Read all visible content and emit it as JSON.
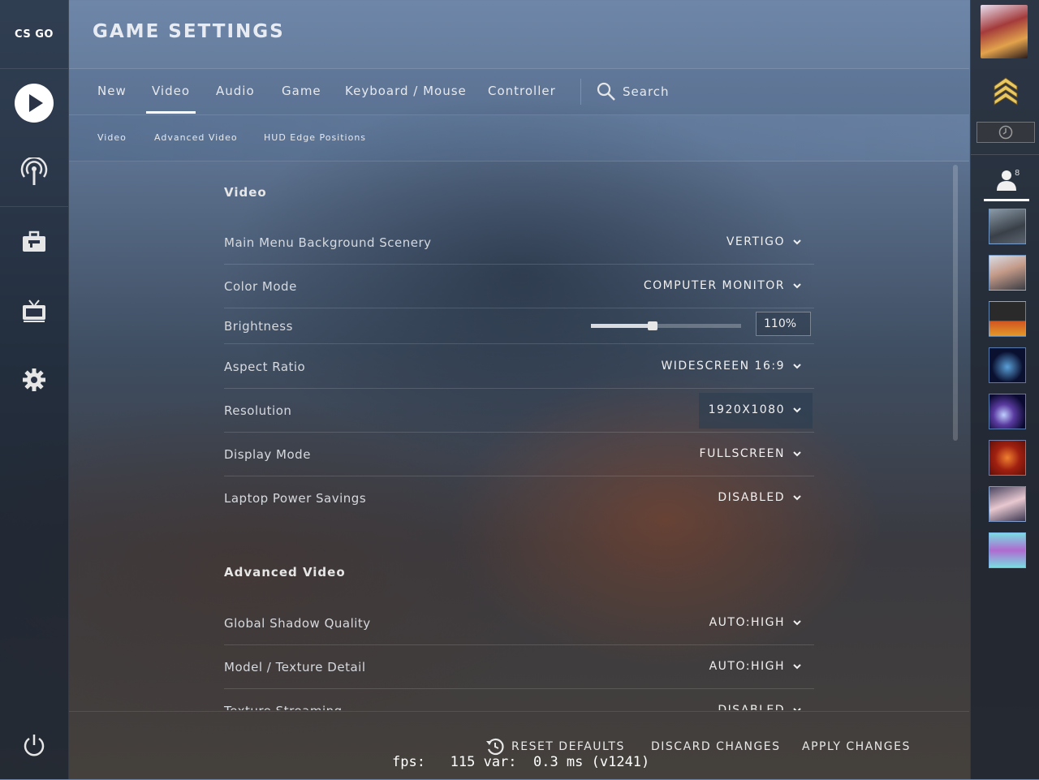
{
  "app": {
    "logo_text": "CS GO"
  },
  "header": {
    "title": "GAME SETTINGS"
  },
  "tabs": [
    {
      "label": "New"
    },
    {
      "label": "Video",
      "active": true
    },
    {
      "label": "Audio"
    },
    {
      "label": "Game"
    },
    {
      "label": "Keyboard / Mouse"
    },
    {
      "label": "Controller"
    }
  ],
  "search": {
    "label": "Search"
  },
  "subtabs": [
    {
      "label": "Video"
    },
    {
      "label": "Advanced Video"
    },
    {
      "label": "HUD Edge Positions"
    }
  ],
  "sections": {
    "video": {
      "title": "Video",
      "rows": [
        {
          "label": "Main Menu Background Scenery",
          "value": "VERTIGO"
        },
        {
          "label": "Color Mode",
          "value": "COMPUTER MONITOR"
        },
        {
          "label": "Brightness",
          "value": "110%",
          "slider_fraction": 0.41
        },
        {
          "label": "Aspect Ratio",
          "value": "WIDESCREEN 16:9"
        },
        {
          "label": "Resolution",
          "value": "1920X1080"
        },
        {
          "label": "Display Mode",
          "value": "FULLSCREEN"
        },
        {
          "label": "Laptop Power Savings",
          "value": "DISABLED"
        }
      ]
    },
    "advanced_video": {
      "title": "Advanced Video",
      "rows": [
        {
          "label": "Global Shadow Quality",
          "value": "AUTO:HIGH"
        },
        {
          "label": "Model / Texture Detail",
          "value": "AUTO:HIGH"
        },
        {
          "label": "Texture Streaming",
          "value": "DISABLED"
        }
      ]
    }
  },
  "footer": {
    "reset_label": "RESET DEFAULTS",
    "discard_label": "DISCARD CHANGES",
    "apply_label": "APPLY CHANGES"
  },
  "fps_overlay": "fps:   115 var:  0.3 ms (v1241)",
  "friends": {
    "count": "8"
  },
  "colors": {
    "accent": "#ffffff",
    "text": "#e6e6e6",
    "friend_border": "#78aae6"
  },
  "icons": {
    "nav": [
      "play-icon",
      "broadcast-icon",
      "briefcase-icon",
      "tv-icon",
      "gear-icon",
      "power-icon"
    ],
    "search": "search-icon",
    "reset": "history-icon",
    "rank": "rank-chevron-icon",
    "status": "clock-icon",
    "friends_tab": "person-icon"
  }
}
